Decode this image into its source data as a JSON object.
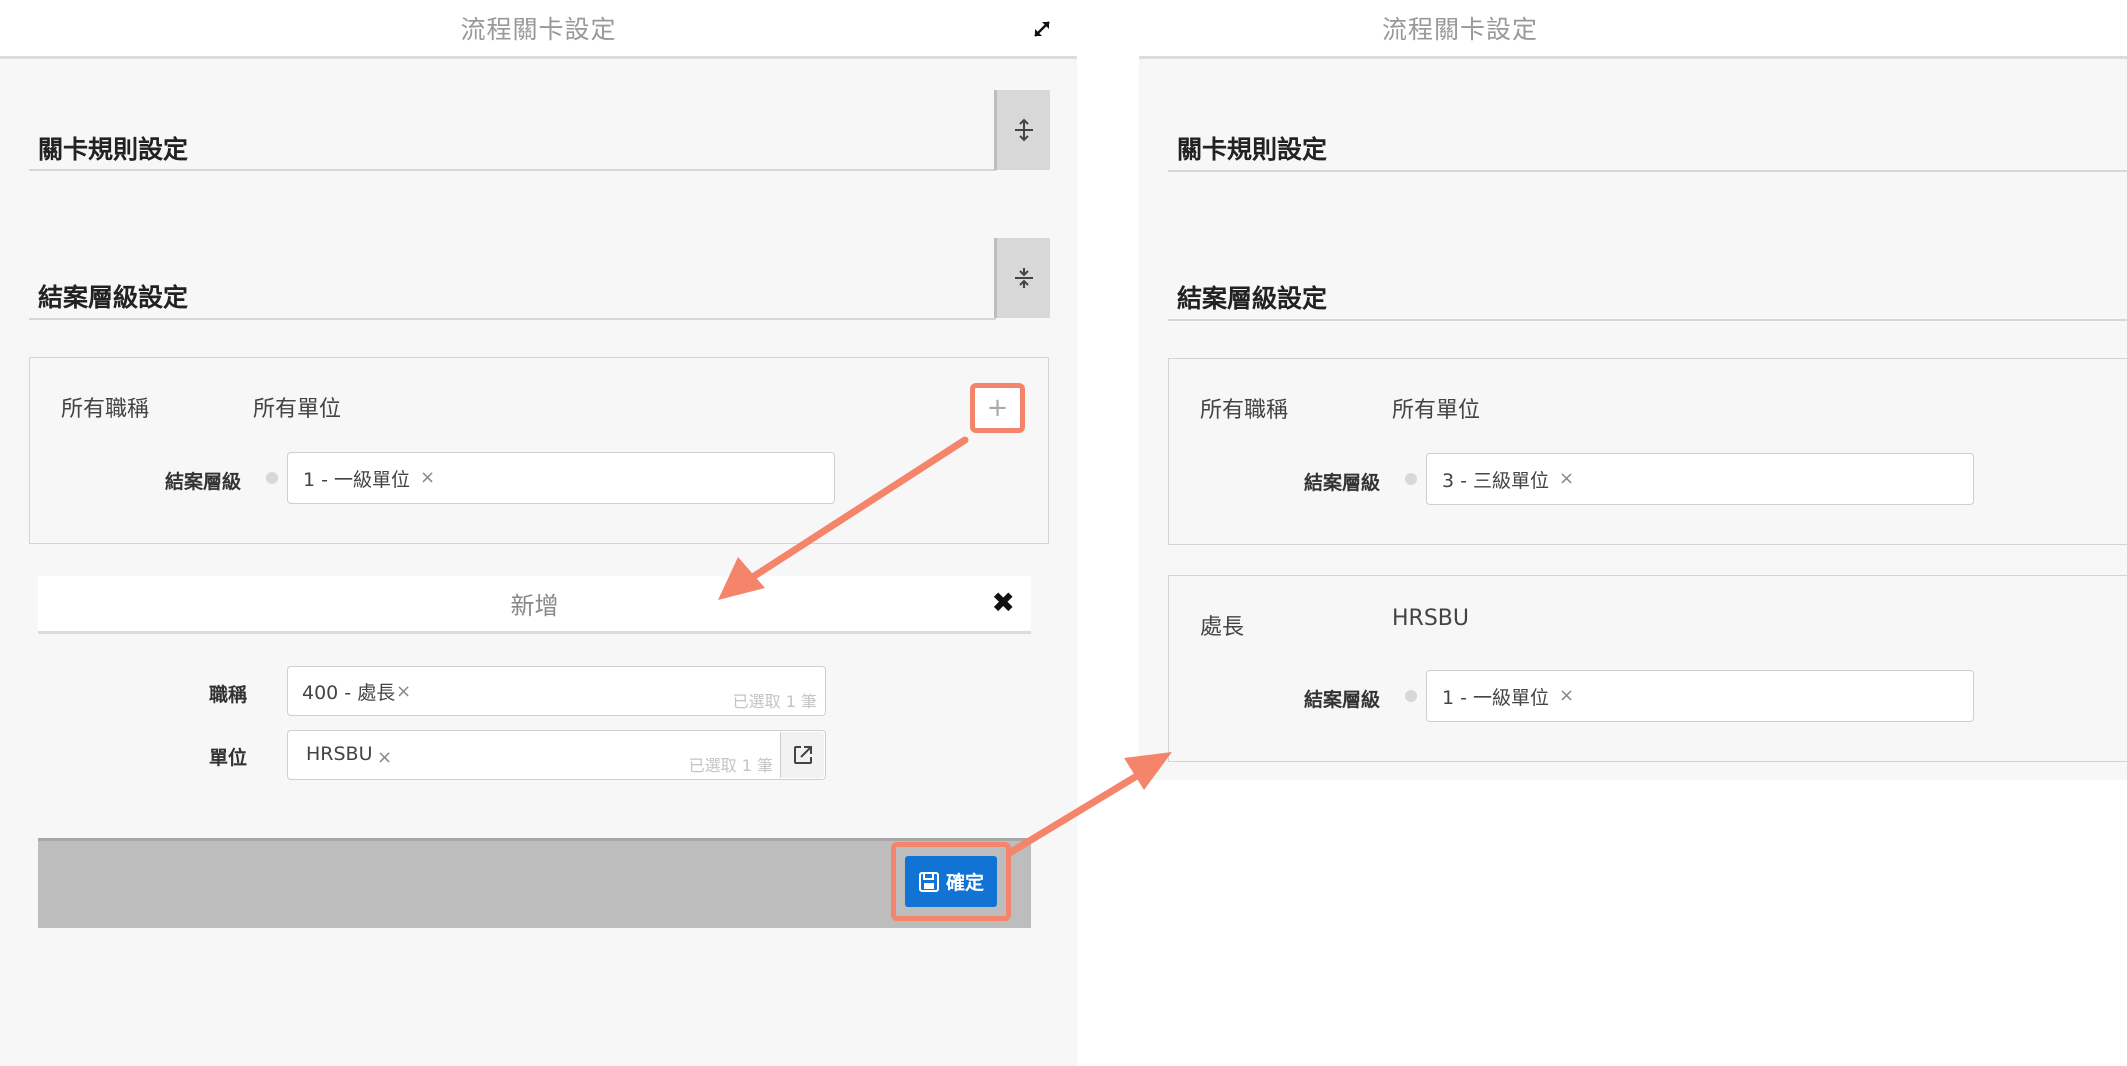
{
  "left": {
    "header_title": "流程關卡設定",
    "section_rules_title": "關卡規則設定",
    "section_close_title": "結案層級設定",
    "rule": {
      "job_title": "所有職稱",
      "unit": "所有單位",
      "level_label": "結案層級",
      "level_tag": "1 - 一級單位",
      "tag_remove": "×"
    },
    "add_button": "+",
    "dialog": {
      "title": "新增",
      "close": "✖",
      "job_title_label": "職稱",
      "job_title_tag": "400 - 處長",
      "job_title_count": "已選取 1 筆",
      "unit_label": "單位",
      "unit_tag": "HRSBU",
      "unit_count": "已選取 1 筆",
      "tag_remove": "×",
      "confirm_label": "確定"
    }
  },
  "right": {
    "header_title": "流程關卡設定",
    "section_rules_title": "關卡規則設定",
    "section_close_title": "結案層級設定",
    "rules": [
      {
        "job_title": "所有職稱",
        "unit": "所有單位",
        "level_label": "結案層級",
        "level_tag": "3 - 三級單位",
        "tag_remove": "×"
      },
      {
        "job_title": "處長",
        "unit": "HRSBU",
        "level_label": "結案層級",
        "level_tag": "1 - 一級單位",
        "tag_remove": "×"
      }
    ]
  },
  "colors": {
    "accent_highlight": "#f4846a",
    "primary_button": "#1173d4"
  }
}
